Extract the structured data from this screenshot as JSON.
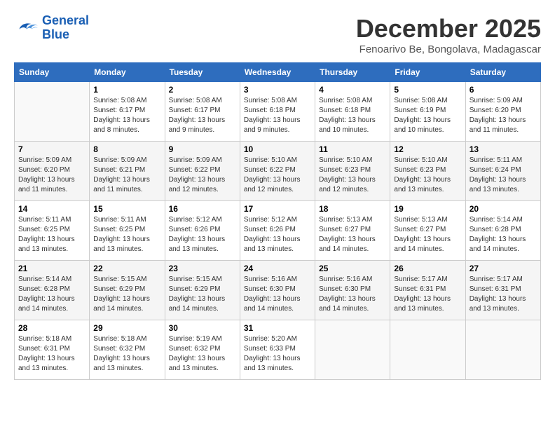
{
  "header": {
    "logo_line1": "General",
    "logo_line2": "Blue",
    "month_year": "December 2025",
    "location": "Fenoarivo Be, Bongolava, Madagascar"
  },
  "weekdays": [
    "Sunday",
    "Monday",
    "Tuesday",
    "Wednesday",
    "Thursday",
    "Friday",
    "Saturday"
  ],
  "weeks": [
    [
      {
        "day": "",
        "info": ""
      },
      {
        "day": "1",
        "info": "Sunrise: 5:08 AM\nSunset: 6:17 PM\nDaylight: 13 hours\nand 8 minutes."
      },
      {
        "day": "2",
        "info": "Sunrise: 5:08 AM\nSunset: 6:17 PM\nDaylight: 13 hours\nand 9 minutes."
      },
      {
        "day": "3",
        "info": "Sunrise: 5:08 AM\nSunset: 6:18 PM\nDaylight: 13 hours\nand 9 minutes."
      },
      {
        "day": "4",
        "info": "Sunrise: 5:08 AM\nSunset: 6:18 PM\nDaylight: 13 hours\nand 10 minutes."
      },
      {
        "day": "5",
        "info": "Sunrise: 5:08 AM\nSunset: 6:19 PM\nDaylight: 13 hours\nand 10 minutes."
      },
      {
        "day": "6",
        "info": "Sunrise: 5:09 AM\nSunset: 6:20 PM\nDaylight: 13 hours\nand 11 minutes."
      }
    ],
    [
      {
        "day": "7",
        "info": "Sunrise: 5:09 AM\nSunset: 6:20 PM\nDaylight: 13 hours\nand 11 minutes."
      },
      {
        "day": "8",
        "info": "Sunrise: 5:09 AM\nSunset: 6:21 PM\nDaylight: 13 hours\nand 11 minutes."
      },
      {
        "day": "9",
        "info": "Sunrise: 5:09 AM\nSunset: 6:22 PM\nDaylight: 13 hours\nand 12 minutes."
      },
      {
        "day": "10",
        "info": "Sunrise: 5:10 AM\nSunset: 6:22 PM\nDaylight: 13 hours\nand 12 minutes."
      },
      {
        "day": "11",
        "info": "Sunrise: 5:10 AM\nSunset: 6:23 PM\nDaylight: 13 hours\nand 12 minutes."
      },
      {
        "day": "12",
        "info": "Sunrise: 5:10 AM\nSunset: 6:23 PM\nDaylight: 13 hours\nand 13 minutes."
      },
      {
        "day": "13",
        "info": "Sunrise: 5:11 AM\nSunset: 6:24 PM\nDaylight: 13 hours\nand 13 minutes."
      }
    ],
    [
      {
        "day": "14",
        "info": "Sunrise: 5:11 AM\nSunset: 6:25 PM\nDaylight: 13 hours\nand 13 minutes."
      },
      {
        "day": "15",
        "info": "Sunrise: 5:11 AM\nSunset: 6:25 PM\nDaylight: 13 hours\nand 13 minutes."
      },
      {
        "day": "16",
        "info": "Sunrise: 5:12 AM\nSunset: 6:26 PM\nDaylight: 13 hours\nand 13 minutes."
      },
      {
        "day": "17",
        "info": "Sunrise: 5:12 AM\nSunset: 6:26 PM\nDaylight: 13 hours\nand 13 minutes."
      },
      {
        "day": "18",
        "info": "Sunrise: 5:13 AM\nSunset: 6:27 PM\nDaylight: 13 hours\nand 14 minutes."
      },
      {
        "day": "19",
        "info": "Sunrise: 5:13 AM\nSunset: 6:27 PM\nDaylight: 13 hours\nand 14 minutes."
      },
      {
        "day": "20",
        "info": "Sunrise: 5:14 AM\nSunset: 6:28 PM\nDaylight: 13 hours\nand 14 minutes."
      }
    ],
    [
      {
        "day": "21",
        "info": "Sunrise: 5:14 AM\nSunset: 6:28 PM\nDaylight: 13 hours\nand 14 minutes."
      },
      {
        "day": "22",
        "info": "Sunrise: 5:15 AM\nSunset: 6:29 PM\nDaylight: 13 hours\nand 14 minutes."
      },
      {
        "day": "23",
        "info": "Sunrise: 5:15 AM\nSunset: 6:29 PM\nDaylight: 13 hours\nand 14 minutes."
      },
      {
        "day": "24",
        "info": "Sunrise: 5:16 AM\nSunset: 6:30 PM\nDaylight: 13 hours\nand 14 minutes."
      },
      {
        "day": "25",
        "info": "Sunrise: 5:16 AM\nSunset: 6:30 PM\nDaylight: 13 hours\nand 14 minutes."
      },
      {
        "day": "26",
        "info": "Sunrise: 5:17 AM\nSunset: 6:31 PM\nDaylight: 13 hours\nand 13 minutes."
      },
      {
        "day": "27",
        "info": "Sunrise: 5:17 AM\nSunset: 6:31 PM\nDaylight: 13 hours\nand 13 minutes."
      }
    ],
    [
      {
        "day": "28",
        "info": "Sunrise: 5:18 AM\nSunset: 6:31 PM\nDaylight: 13 hours\nand 13 minutes."
      },
      {
        "day": "29",
        "info": "Sunrise: 5:18 AM\nSunset: 6:32 PM\nDaylight: 13 hours\nand 13 minutes."
      },
      {
        "day": "30",
        "info": "Sunrise: 5:19 AM\nSunset: 6:32 PM\nDaylight: 13 hours\nand 13 minutes."
      },
      {
        "day": "31",
        "info": "Sunrise: 5:20 AM\nSunset: 6:33 PM\nDaylight: 13 hours\nand 13 minutes."
      },
      {
        "day": "",
        "info": ""
      },
      {
        "day": "",
        "info": ""
      },
      {
        "day": "",
        "info": ""
      }
    ]
  ]
}
